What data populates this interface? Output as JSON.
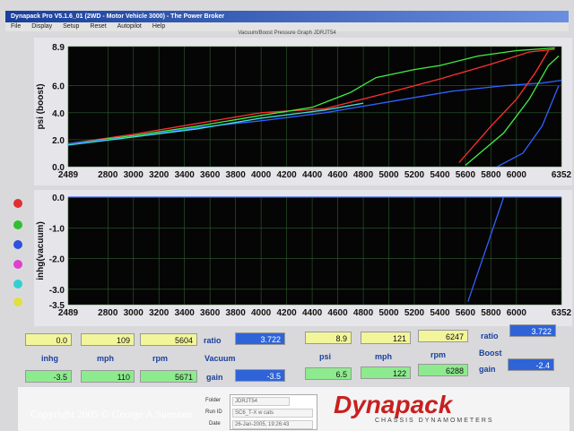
{
  "window": {
    "title": "Dynapack Pro V5.1.6_01 (2WD - Motor Vehicle 3000) - The Power Broker"
  },
  "menu": [
    "File",
    "Display",
    "Setup",
    "Reset",
    "Autopilot",
    "Help"
  ],
  "graph_title": "Vacuum/Boost Pressure Graph  JDRJT54",
  "chart_data": [
    {
      "type": "line",
      "ylabel": "psi (boost)",
      "xlim": [
        2489,
        6352
      ],
      "ylim": [
        0.0,
        8.9
      ],
      "x_ticks": [
        "2489",
        "2800",
        "3000",
        "3200",
        "3400",
        "3600",
        "3800",
        "4000",
        "4200",
        "4400",
        "4600",
        "4800",
        "5000",
        "5200",
        "5400",
        "5600",
        "5800",
        "6000",
        "6352"
      ],
      "y_ticks": [
        "0.0",
        "2.0",
        "4.0",
        "6.0",
        "8.9"
      ],
      "series": [
        {
          "color": "#ff3030",
          "points": [
            [
              2489,
              1.7
            ],
            [
              3000,
              2.4
            ],
            [
              3500,
              3.2
            ],
            [
              4000,
              4.0
            ],
            [
              4500,
              4.3
            ],
            [
              5000,
              5.5
            ],
            [
              5400,
              6.5
            ],
            [
              5800,
              7.6
            ],
            [
              6100,
              8.5
            ],
            [
              6300,
              8.7
            ]
          ]
        },
        {
          "color": "#40f040",
          "points": [
            [
              2489,
              1.7
            ],
            [
              3000,
              2.3
            ],
            [
              3500,
              3.0
            ],
            [
              4000,
              3.8
            ],
            [
              4400,
              4.4
            ],
            [
              4700,
              5.5
            ],
            [
              4900,
              6.6
            ],
            [
              5200,
              7.2
            ],
            [
              5400,
              7.5
            ],
            [
              5700,
              8.2
            ],
            [
              6000,
              8.6
            ],
            [
              6300,
              8.8
            ]
          ]
        },
        {
          "color": "#3060ff",
          "points": [
            [
              2489,
              1.7
            ],
            [
              3000,
              2.2
            ],
            [
              3500,
              2.9
            ],
            [
              4000,
              3.4
            ],
            [
              4500,
              4.0
            ],
            [
              5000,
              4.8
            ],
            [
              5500,
              5.6
            ],
            [
              5900,
              6.0
            ],
            [
              6200,
              6.2
            ],
            [
              6352,
              6.4
            ]
          ]
        },
        {
          "color": "#40e0e0",
          "points": [
            [
              2489,
              1.6
            ],
            [
              3000,
              2.2
            ],
            [
              3500,
              2.8
            ],
            [
              4000,
              3.6
            ],
            [
              4500,
              4.2
            ],
            [
              4800,
              4.7
            ]
          ]
        },
        {
          "color": "#ff3030",
          "points": [
            [
              5550,
              0.3
            ],
            [
              5800,
              3.0
            ],
            [
              6000,
              5.0
            ],
            [
              6150,
              7.0
            ],
            [
              6250,
              8.6
            ]
          ]
        },
        {
          "color": "#40f040",
          "points": [
            [
              5600,
              0.1
            ],
            [
              5900,
              2.5
            ],
            [
              6100,
              5.0
            ],
            [
              6250,
              7.5
            ],
            [
              6330,
              8.2
            ]
          ]
        },
        {
          "color": "#3060ff",
          "points": [
            [
              5850,
              0.0
            ],
            [
              6050,
              1.0
            ],
            [
              6200,
              3.0
            ],
            [
              6330,
              6.0
            ]
          ]
        }
      ]
    },
    {
      "type": "line",
      "ylabel": "inhg(vacuum)",
      "xlim": [
        2489,
        6352
      ],
      "ylim": [
        -3.5,
        0.0
      ],
      "x_ticks": [
        "2489",
        "2800",
        "3000",
        "3200",
        "3400",
        "3600",
        "3800",
        "4000",
        "4200",
        "4400",
        "4600",
        "4800",
        "5000",
        "5200",
        "5400",
        "5600",
        "5800",
        "6000",
        "6352"
      ],
      "y_ticks": [
        "0.0",
        "-1.0",
        "-2.0",
        "-3.0",
        "-3.5"
      ],
      "series": [
        {
          "color": "#3060ff",
          "points": [
            [
              2489,
              0.0
            ],
            [
              6352,
              0.0
            ]
          ]
        },
        {
          "color": "#3060ff",
          "points": [
            [
              5620,
              -3.4
            ],
            [
              5900,
              0.0
            ]
          ]
        }
      ]
    }
  ],
  "left_readout": {
    "row1": [
      "0.0",
      "109",
      "5604"
    ],
    "labels": [
      "inhg",
      "mph",
      "rpm"
    ],
    "row2": [
      "-3.5",
      "110",
      "5671"
    ],
    "ratio_label": "ratio",
    "ratio_value": "3.722",
    "section_label": "Vacuum",
    "gain_label": "gain",
    "gain_value": "-3.5"
  },
  "right_readout": {
    "row1": [
      "8.9",
      "121",
      "6247"
    ],
    "labels": [
      "psi",
      "mph",
      "rpm"
    ],
    "row2": [
      "6.5",
      "122",
      "6288"
    ],
    "ratio_label": "ratio",
    "ratio_value": "3.722",
    "section_label": "Boost",
    "gain_label": "gain",
    "gain_value": "-2.4"
  },
  "info": {
    "folder_label": "Folder",
    "folder_value": "JDRJT54",
    "run_label": "Run ID",
    "run_value": "SC6_T-X w cats",
    "date_label": "Date",
    "date_value": "26-Jan-2005, 19:26:43"
  },
  "logo": {
    "name": "Dynapack",
    "sub": "CHASSIS DYNAMOMETERS"
  },
  "copyright": "Copyright 2005 © George A Suennen",
  "series_colors": [
    "#e03030",
    "#30c030",
    "#3050e0",
    "#e040d0",
    "#30d0d0",
    "#e0e040"
  ]
}
